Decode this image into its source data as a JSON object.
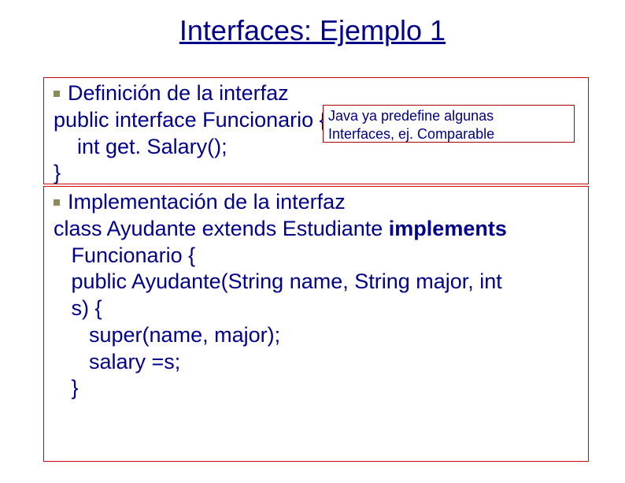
{
  "title": "Interfaces: Ejemplo 1",
  "note": {
    "line1": "Java ya predefine algunas",
    "line2": "Interfaces, ej. Comparable"
  },
  "block1": {
    "bullet": "Definición de la interfaz",
    "line2": "public interface Funcionario {",
    "line3": "    int get. Salary();",
    "line4": "}"
  },
  "block2": {
    "bullet": "Implementación de la interfaz",
    "line2a": "class Ayudante extends Estudiante ",
    "line2b": "implements",
    "line3": "   Funcionario {",
    "line4": "   public Ayudante(String name, String major, int",
    "line5": "   s) {",
    "line6": "      super(name, major);",
    "line7": "      salary =s;",
    "line8": "   }"
  }
}
